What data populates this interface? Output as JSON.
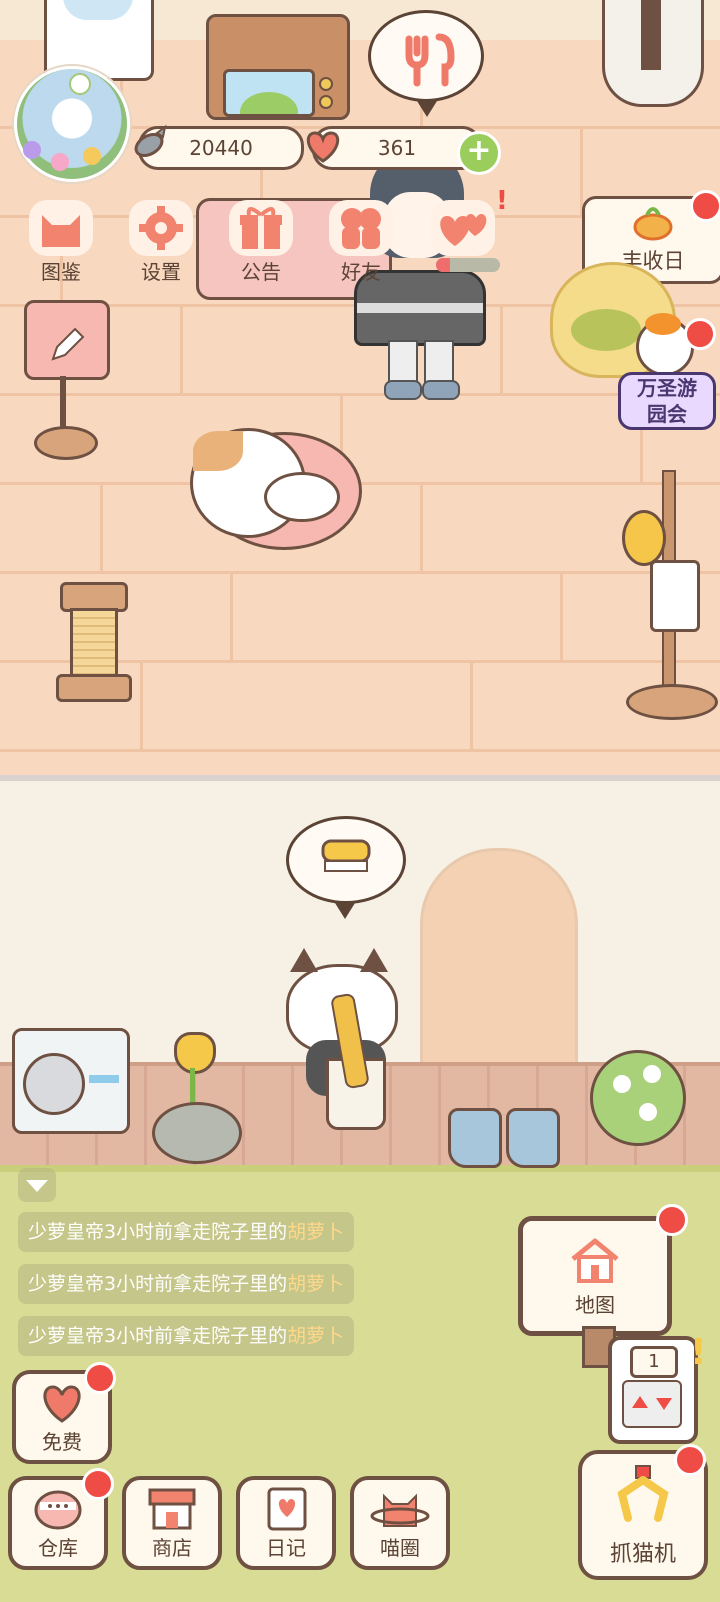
{
  "hud": {
    "fish_currency": "20440",
    "heart_currency": "361"
  },
  "top_menu": [
    {
      "label": "图鉴",
      "icon": "cat-head-icon"
    },
    {
      "label": "设置",
      "icon": "gear-icon"
    },
    {
      "label": "公告",
      "icon": "gift-icon"
    },
    {
      "label": "好友",
      "icon": "friends-icon"
    }
  ],
  "events": {
    "harvest_day": "丰收日",
    "halloween_line1": "万圣游",
    "halloween_line2": "园会"
  },
  "messages": [
    {
      "text": "少萝皇帝3小时前拿走院子里的",
      "item": "胡萝卜"
    },
    {
      "text": "少萝皇帝3小时前拿走院子里的",
      "item": "胡萝卜"
    },
    {
      "text": "少萝皇帝3小时前拿走院子里的",
      "item": "胡萝卜"
    }
  ],
  "map_sign": {
    "label": "地图"
  },
  "ticket_count": "1",
  "free_button": {
    "label": "免费"
  },
  "bottom_bar": [
    {
      "label": "仓库"
    },
    {
      "label": "商店"
    },
    {
      "label": "日记"
    },
    {
      "label": "喵圈"
    }
  ],
  "claw_machine": {
    "label": "抓猫机"
  },
  "colors": {
    "accent_red": "#ef4c46",
    "plus_green": "#9acd5b",
    "outline": "#6e5142"
  }
}
